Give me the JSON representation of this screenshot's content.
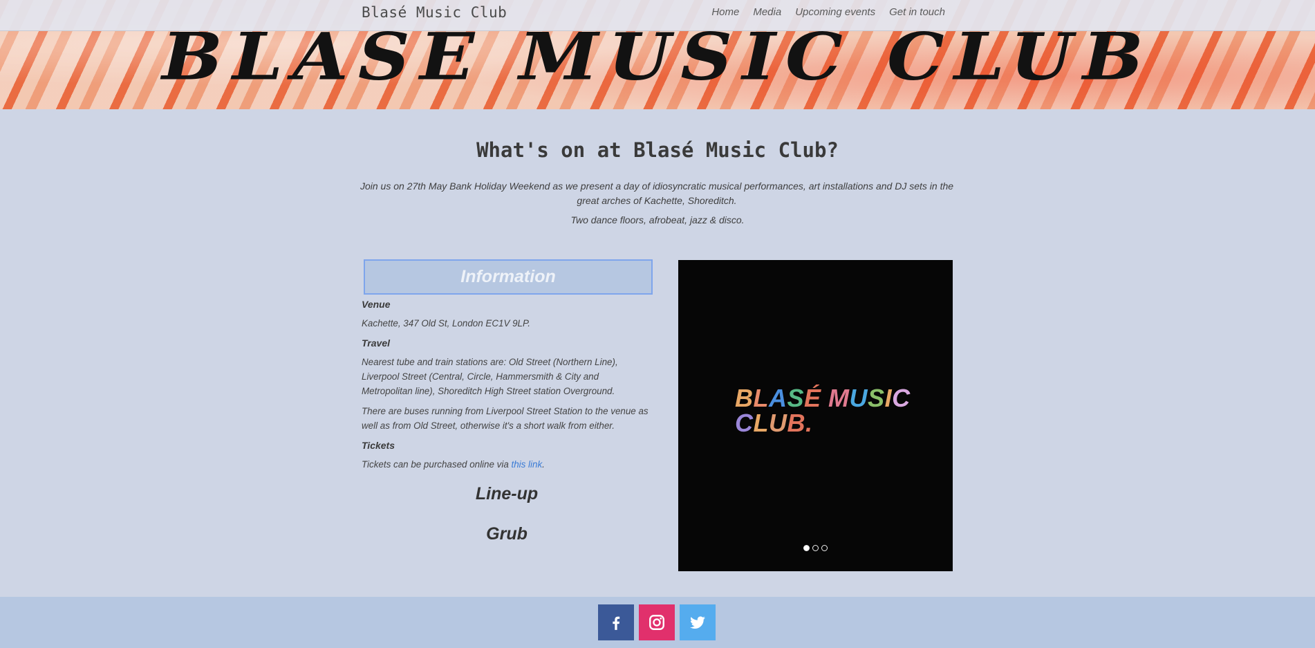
{
  "header": {
    "brand": "Blasé Music Club",
    "nav": [
      "Home",
      "Media",
      "Upcoming events",
      "Get in touch"
    ]
  },
  "hero": {
    "title": "BLASE MUSIC CLUB"
  },
  "intro": {
    "heading": "What's on at Blasé Music Club?",
    "paragraph1": "Join us on 27th May Bank Holiday Weekend as we present a day of idiosyncratic musical performances, art installations and DJ sets in the great arches of Kachette, Shoreditch.",
    "paragraph2": "Two dance floors, afrobeat, jazz & disco."
  },
  "info": {
    "header": "Information",
    "venue_label": "Venue",
    "venue_text": "Kachette, 347 Old St, London EC1V 9LP.",
    "travel_label": "Travel",
    "travel_text1": "Nearest tube and train stations are: Old Street (Northern Line), Liverpool Street (Central, Circle, Hammersmith & City and Metropolitan line), Shoreditch High Street station Overground.",
    "travel_text2": "There are buses running from Liverpool Street Station to the venue as well as from Old Street, otherwise it's a short walk from either.",
    "tickets_label": "Tickets",
    "tickets_text": "Tickets can be purchased online via ",
    "tickets_link": "this link",
    "tickets_end": "."
  },
  "sections": {
    "lineup": "Line-up",
    "grub": "Grub"
  },
  "slider": {
    "logo_line1": [
      "B",
      "L",
      "A",
      "S",
      "É",
      " ",
      "M",
      "U",
      "S",
      "I",
      "C"
    ],
    "logo_line2": [
      "C",
      "L",
      "U",
      "B",
      "."
    ],
    "logo_colors": [
      "#e8a765",
      "#e88a6a",
      "#4a8fe0",
      "#58b986",
      "#e2745c",
      "#ffffff",
      "#e07a8f",
      "#4aa7e0",
      "#8bbf6a",
      "#e8a765",
      "#d9a8e0"
    ],
    "logo_colors2": [
      "#9a86d8",
      "#e8a765",
      "#e09a70",
      "#e2745c",
      "#e2745c"
    ],
    "active_slide": 1,
    "slide_count": 3
  },
  "footer": {
    "socials": [
      {
        "name": "facebook-icon",
        "color": "#3b5998"
      },
      {
        "name": "instagram-icon",
        "color": "#e1306c"
      },
      {
        "name": "twitter-icon",
        "color": "#55acee"
      }
    ]
  }
}
